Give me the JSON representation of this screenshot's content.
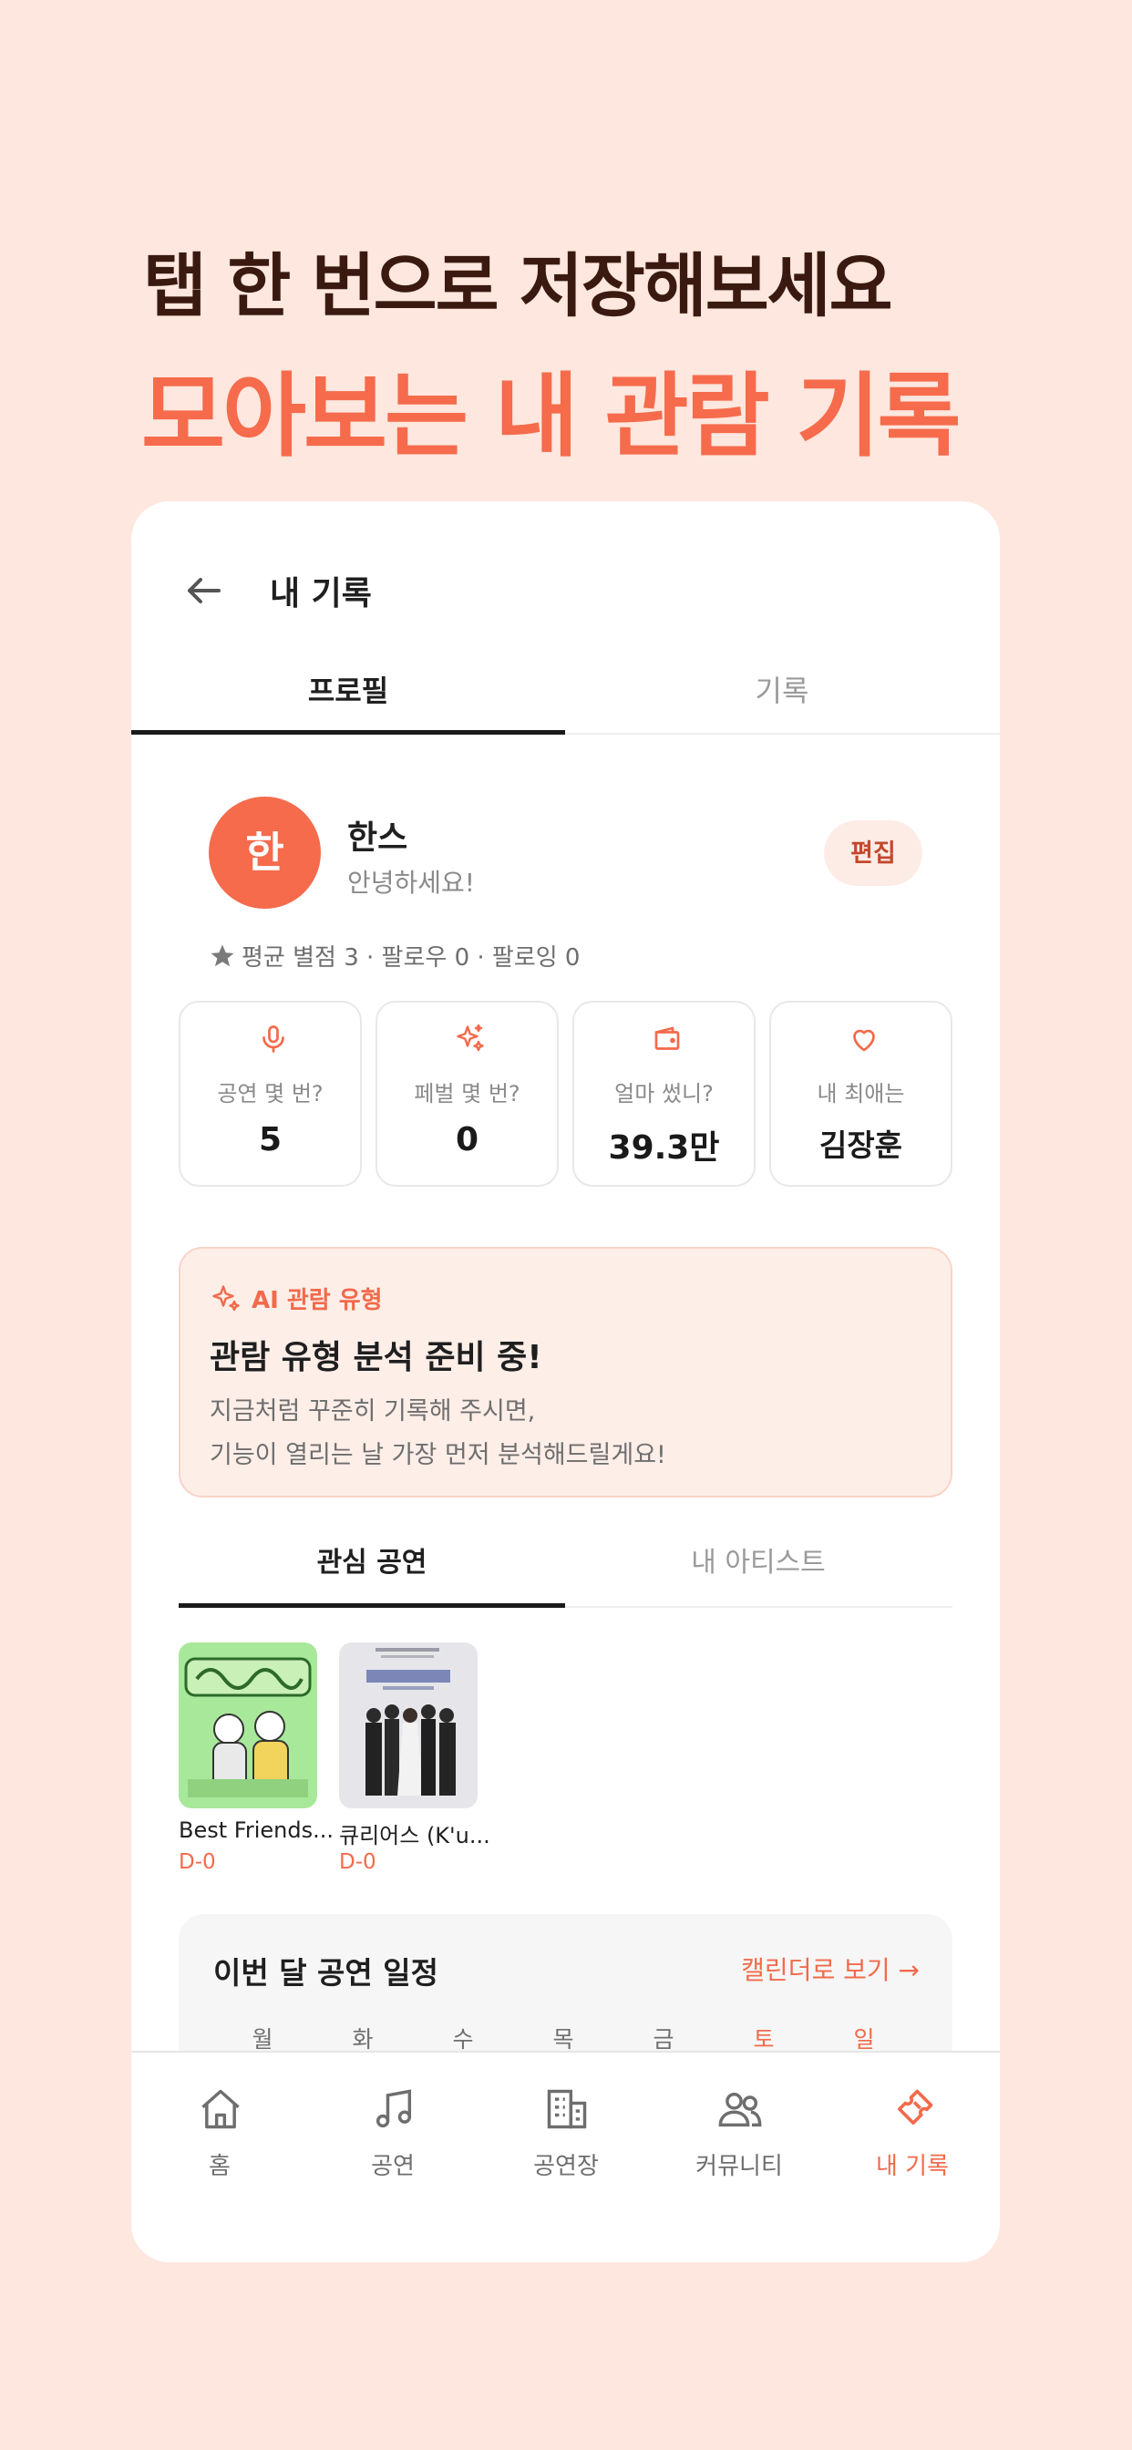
{
  "promo": {
    "line1": "탭 한 번으로 저장해보세요",
    "line2": "모아보는 내 관람 기록"
  },
  "header": {
    "title": "내 기록",
    "back_icon": "arrow-left-icon"
  },
  "tabs": [
    {
      "label": "프로필",
      "active": true
    },
    {
      "label": "기록",
      "active": false
    }
  ],
  "profile": {
    "avatar_initial": "한",
    "name": "한스",
    "bio": "안녕하세요!",
    "edit_label": "편집",
    "stats_text": "평균 별점 3 · 팔로우 0 · 팔로잉 0"
  },
  "stats": [
    {
      "icon": "microphone-icon",
      "label": "공연 몇 번?",
      "value": "5"
    },
    {
      "icon": "sparkles-icon",
      "label": "페벌 몇 번?",
      "value": "0"
    },
    {
      "icon": "wallet-icon",
      "label": "얼마 썼니?",
      "value": "39.3만"
    },
    {
      "icon": "heart-icon",
      "label": "내 최애는",
      "value": "김장훈"
    }
  ],
  "ai_card": {
    "tag": "AI 관람 유형",
    "title": "관람 유형 분석 준비 중!",
    "desc_line1": "지금처럼 꾸준히 기록해 주시면,",
    "desc_line2": "기능이 열리는 날 가장 먼저 분석해드릴게요!"
  },
  "subtabs": [
    {
      "label": "관심 공연",
      "active": true
    },
    {
      "label": "내 아티스트",
      "active": false
    }
  ],
  "interests": [
    {
      "title": "Best Friends...",
      "dday": "D-0"
    },
    {
      "title": "큐리어스 (K'u...",
      "dday": "D-0"
    }
  ],
  "calendar": {
    "title": "이번 달 공연 일정",
    "link": "캘린더로 보기 →",
    "weekdays": [
      "월",
      "화",
      "수",
      "목",
      "금",
      "토",
      "일"
    ]
  },
  "bottom_nav": [
    {
      "icon": "home-icon",
      "label": "홈"
    },
    {
      "icon": "music-note-icon",
      "label": "공연"
    },
    {
      "icon": "building-icon",
      "label": "공연장"
    },
    {
      "icon": "people-icon",
      "label": "커뮤니티"
    },
    {
      "icon": "ticket-icon",
      "label": "내 기록",
      "active": true
    }
  ],
  "colors": {
    "accent": "#f56b4c",
    "background": "#fde7de",
    "card": "#ffffff"
  }
}
